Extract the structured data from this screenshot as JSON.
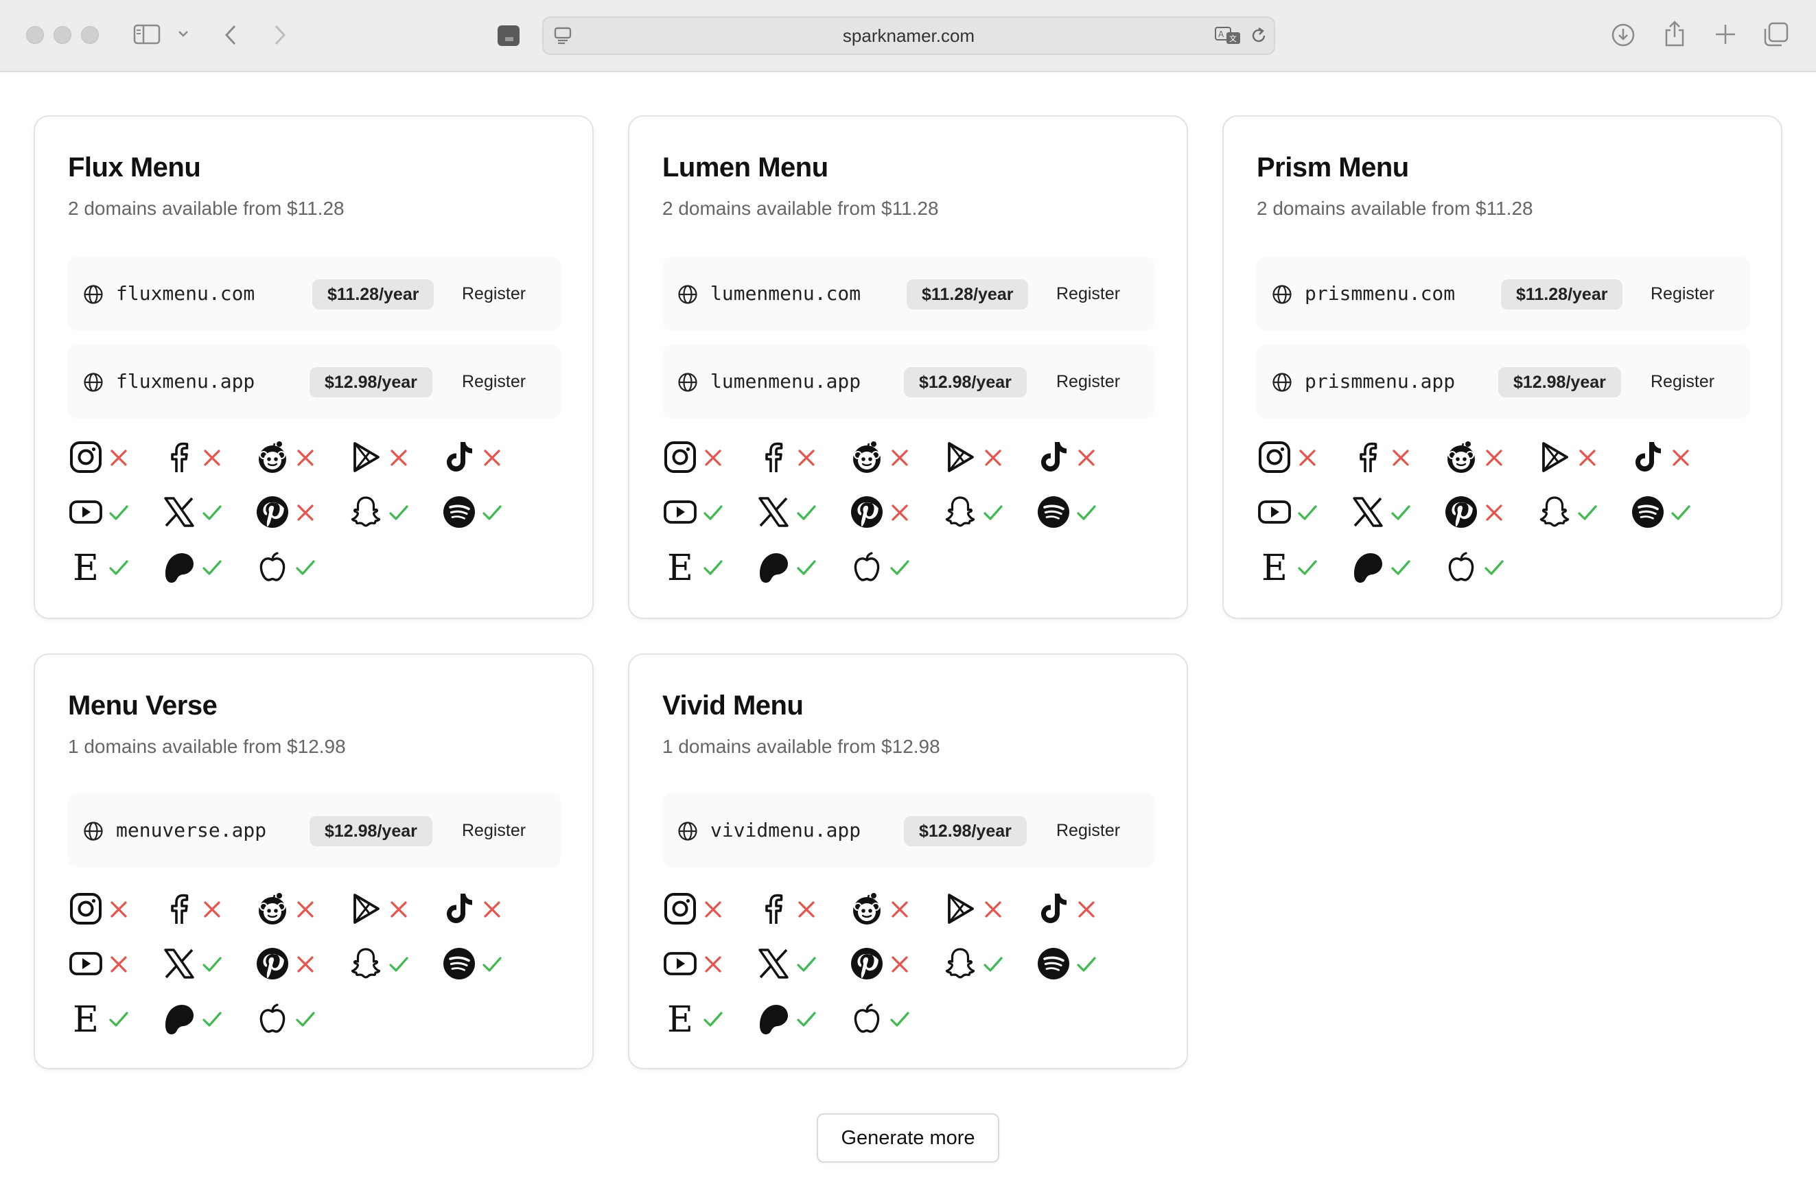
{
  "browser": {
    "url": "sparknamer.com"
  },
  "colors": {
    "available": "#3fb950",
    "taken": "#e5534b"
  },
  "platforms": [
    "instagram-icon",
    "facebook-icon",
    "reddit-icon",
    "google-play-icon",
    "tiktok-icon",
    "youtube-icon",
    "x-icon",
    "pinterest-icon",
    "snapchat-icon",
    "spotify-icon",
    "etsy-icon",
    "patreon-icon",
    "apple-icon"
  ],
  "cards": [
    {
      "title": "Flux Menu",
      "subtitle": "2 domains available from $11.28",
      "domains": [
        {
          "name": "fluxmenu.com",
          "price": "$11.28/year",
          "action": "Register"
        },
        {
          "name": "fluxmenu.app",
          "price": "$12.98/year",
          "action": "Register"
        }
      ],
      "social": [
        false,
        false,
        false,
        false,
        false,
        true,
        true,
        false,
        true,
        true,
        true,
        true,
        true
      ]
    },
    {
      "title": "Lumen Menu",
      "subtitle": "2 domains available from $11.28",
      "domains": [
        {
          "name": "lumenmenu.com",
          "price": "$11.28/year",
          "action": "Register"
        },
        {
          "name": "lumenmenu.app",
          "price": "$12.98/year",
          "action": "Register"
        }
      ],
      "social": [
        false,
        false,
        false,
        false,
        false,
        true,
        true,
        false,
        true,
        true,
        true,
        true,
        true
      ]
    },
    {
      "title": "Prism Menu",
      "subtitle": "2 domains available from $11.28",
      "domains": [
        {
          "name": "prismmenu.com",
          "price": "$11.28/year",
          "action": "Register"
        },
        {
          "name": "prismmenu.app",
          "price": "$12.98/year",
          "action": "Register"
        }
      ],
      "social": [
        false,
        false,
        false,
        false,
        false,
        true,
        true,
        false,
        true,
        true,
        true,
        true,
        true
      ]
    },
    {
      "title": "Menu Verse",
      "subtitle": "1 domains available from $12.98",
      "domains": [
        {
          "name": "menuverse.app",
          "price": "$12.98/year",
          "action": "Register"
        }
      ],
      "social": [
        false,
        false,
        false,
        false,
        false,
        false,
        true,
        false,
        true,
        true,
        true,
        true,
        true
      ]
    },
    {
      "title": "Vivid Menu",
      "subtitle": "1 domains available from $12.98",
      "domains": [
        {
          "name": "vividmenu.app",
          "price": "$12.98/year",
          "action": "Register"
        }
      ],
      "social": [
        false,
        false,
        false,
        false,
        false,
        false,
        true,
        false,
        true,
        true,
        true,
        true,
        true
      ]
    }
  ],
  "generate_label": "Generate more"
}
